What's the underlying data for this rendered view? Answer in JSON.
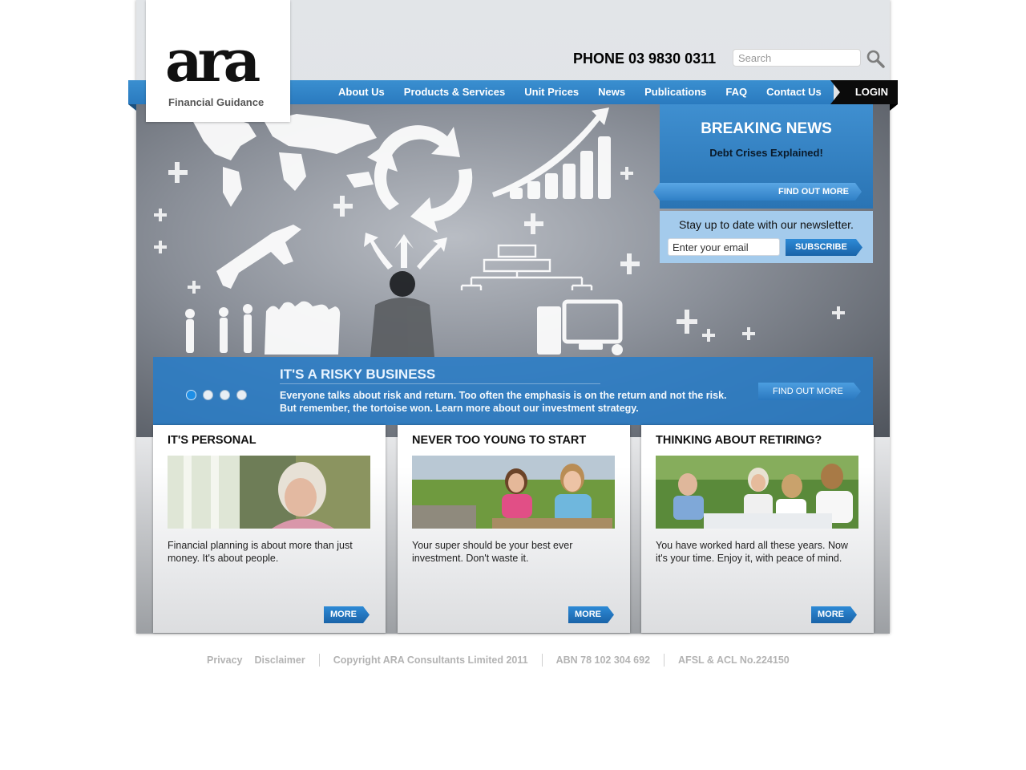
{
  "brand": {
    "logo_text": "ara",
    "tagline": "Financial Guidance"
  },
  "header": {
    "phone": "PHONE 03 9830 0311",
    "search_placeholder": "Search"
  },
  "nav": {
    "items": [
      {
        "label": "About Us"
      },
      {
        "label": "Products & Services"
      },
      {
        "label": "Unit Prices"
      },
      {
        "label": "News"
      },
      {
        "label": "Publications"
      },
      {
        "label": "FAQ"
      },
      {
        "label": "Contact Us"
      }
    ],
    "login": "LOGIN"
  },
  "breaking_news": {
    "title": "BREAKING NEWS",
    "subtitle": "Debt Crises Explained!",
    "cta": "FIND OUT MORE"
  },
  "newsletter": {
    "text": "Stay up to date with our newsletter.",
    "email_placeholder": "Enter your email",
    "button": "SUBSCRIBE"
  },
  "banner": {
    "title": "IT'S A RISKY BUSINESS",
    "text": "Everyone talks about risk and return. Too often the emphasis is on the return and not the risk. But remember, the tortoise won. Learn more about our investment strategy.",
    "cta": "FIND OUT MORE",
    "slides_total": 4,
    "active_slide": 1
  },
  "cards": [
    {
      "title": "IT'S PERSONAL",
      "text": "Financial planning is about more than just money. It's about people.",
      "more": "MORE"
    },
    {
      "title": "NEVER TOO YOUNG TO START",
      "text": "Your super should be your best ever investment. Don't waste it.",
      "more": "MORE"
    },
    {
      "title": "THINKING ABOUT RETIRING?",
      "text": "You have worked hard all these years. Now it's your time. Enjoy it, with peace of mind.",
      "more": "MORE"
    }
  ],
  "footer": {
    "privacy": "Privacy",
    "disclaimer": "Disclaimer",
    "copyright": "Copyright ARA Consultants Limited 2011",
    "abn": "ABN 78 102 304 692",
    "afsl": "AFSL & ACL No.224150"
  },
  "colors": {
    "accent_blue": "#2a7abf",
    "login_black": "#0b0b0b",
    "newsletter_bg": "#a4cbec"
  }
}
